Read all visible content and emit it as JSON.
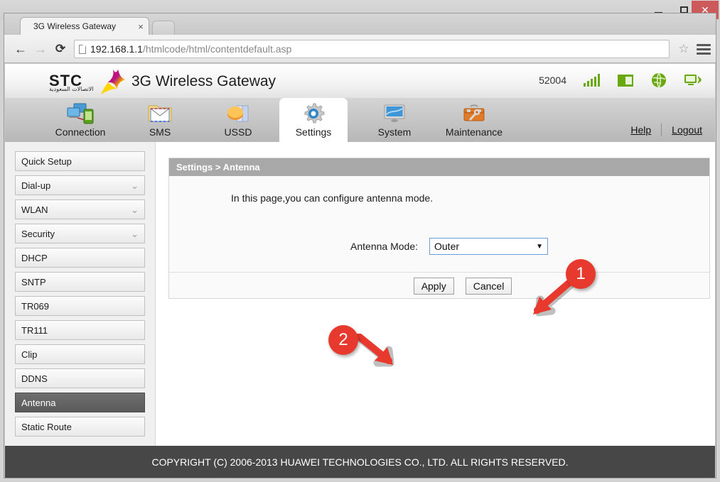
{
  "window": {
    "minimize_label": "—",
    "maximize_label": "□",
    "close_label": "✕"
  },
  "browser": {
    "tab_title": "3G Wireless Gateway",
    "tab_close": "×",
    "back_icon": "←",
    "forward_icon": "→",
    "reload_icon": "⟳",
    "url_host": "192.168.1.1",
    "url_path": "/htmlcode/html/contentdefault.asp",
    "star_icon": "☆"
  },
  "header": {
    "brand_word": "STC",
    "brand_arabic": "الاتصالات السعودية",
    "app_title": "3G Wireless Gateway",
    "status_code": "52004",
    "status_icons": [
      "signal-bars-icon",
      "sim-card-icon",
      "globe-icon",
      "wifi-monitor-icon"
    ],
    "accent_green": "#6aa80f"
  },
  "nav": {
    "tabs": [
      {
        "label": "Connection",
        "icon": "connection-icon",
        "active": false
      },
      {
        "label": "SMS",
        "icon": "sms-envelope-icon",
        "active": false
      },
      {
        "label": "USSD",
        "icon": "ussd-icon",
        "active": false
      },
      {
        "label": "Settings",
        "icon": "gear-icon",
        "active": true
      },
      {
        "label": "System",
        "icon": "monitor-icon",
        "active": false
      },
      {
        "label": "Maintenance",
        "icon": "toolbox-icon",
        "active": false
      }
    ],
    "help_label": "Help",
    "logout_label": "Logout"
  },
  "sidebar": {
    "items": [
      {
        "label": "Quick Setup",
        "expandable": false,
        "selected": false
      },
      {
        "label": "Dial-up",
        "expandable": true,
        "selected": false
      },
      {
        "label": "WLAN",
        "expandable": true,
        "selected": false
      },
      {
        "label": "Security",
        "expandable": true,
        "selected": false
      },
      {
        "label": "DHCP",
        "expandable": false,
        "selected": false
      },
      {
        "label": "SNTP",
        "expandable": false,
        "selected": false
      },
      {
        "label": "TR069",
        "expandable": false,
        "selected": false
      },
      {
        "label": "TR111",
        "expandable": false,
        "selected": false
      },
      {
        "label": "Clip",
        "expandable": false,
        "selected": false
      },
      {
        "label": "DDNS",
        "expandable": false,
        "selected": false
      },
      {
        "label": "Antenna",
        "expandable": false,
        "selected": true
      },
      {
        "label": "Static Route",
        "expandable": false,
        "selected": false
      }
    ],
    "chevron_icon": "⌄"
  },
  "main": {
    "breadcrumb": "Settings > Antenna",
    "description": "In this page,you can configure antenna mode.",
    "field_label": "Antenna Mode:",
    "antenna_mode_value": "Outer",
    "antenna_mode_options": [
      "Outer"
    ],
    "select_arrow": "▼",
    "apply_label": "Apply",
    "cancel_label": "Cancel"
  },
  "annotations": {
    "badge_one": "1",
    "badge_two": "2",
    "badge_color": "#e8392e"
  },
  "footer": {
    "copyright": "COPYRIGHT (C) 2006-2013 HUAWEI TECHNOLOGIES CO., LTD. ALL RIGHTS RESERVED."
  }
}
